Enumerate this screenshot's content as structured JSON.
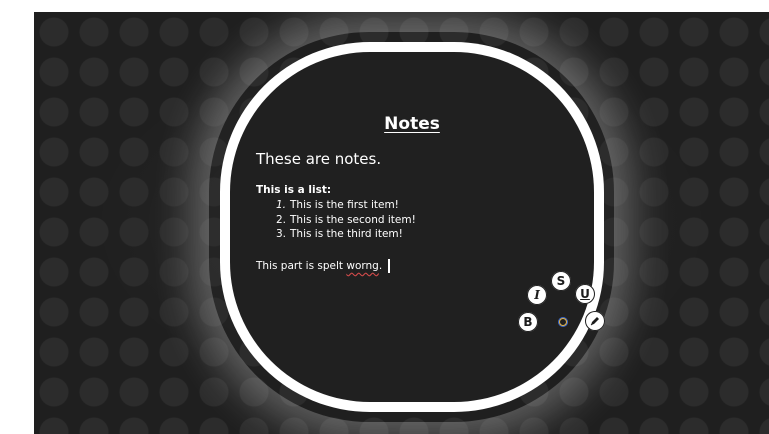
{
  "note": {
    "title": "Notes",
    "heading": "These are notes.",
    "list_title": "This is a list:",
    "list_items": [
      {
        "number": "1.",
        "text": "This is the first item!"
      },
      {
        "number": "2.",
        "text": "This is the second item!"
      },
      {
        "number": "3.",
        "text": "This is the third item!"
      }
    ],
    "spell_line_prefix": "This part is spelt ",
    "misspelled_word": "worng",
    "spell_line_suffix": "."
  },
  "format_wheel": {
    "bold_label": "B",
    "italic_label": "I",
    "strike_label": "S",
    "underline_label": "U",
    "bold_icon": "bold-icon",
    "italic_icon": "italic-icon",
    "strike_icon": "strikethrough-icon",
    "underline_icon": "underline-icon",
    "pen_icon": "pen-icon",
    "indicator_icon": "color-ring-icon"
  },
  "colors": {
    "panel_background": "#202020",
    "bezel": "#ffffff",
    "text": "#ffffff",
    "spellcheck_underline": "#d24a4a",
    "indicator_ring": "#e8b84a"
  }
}
